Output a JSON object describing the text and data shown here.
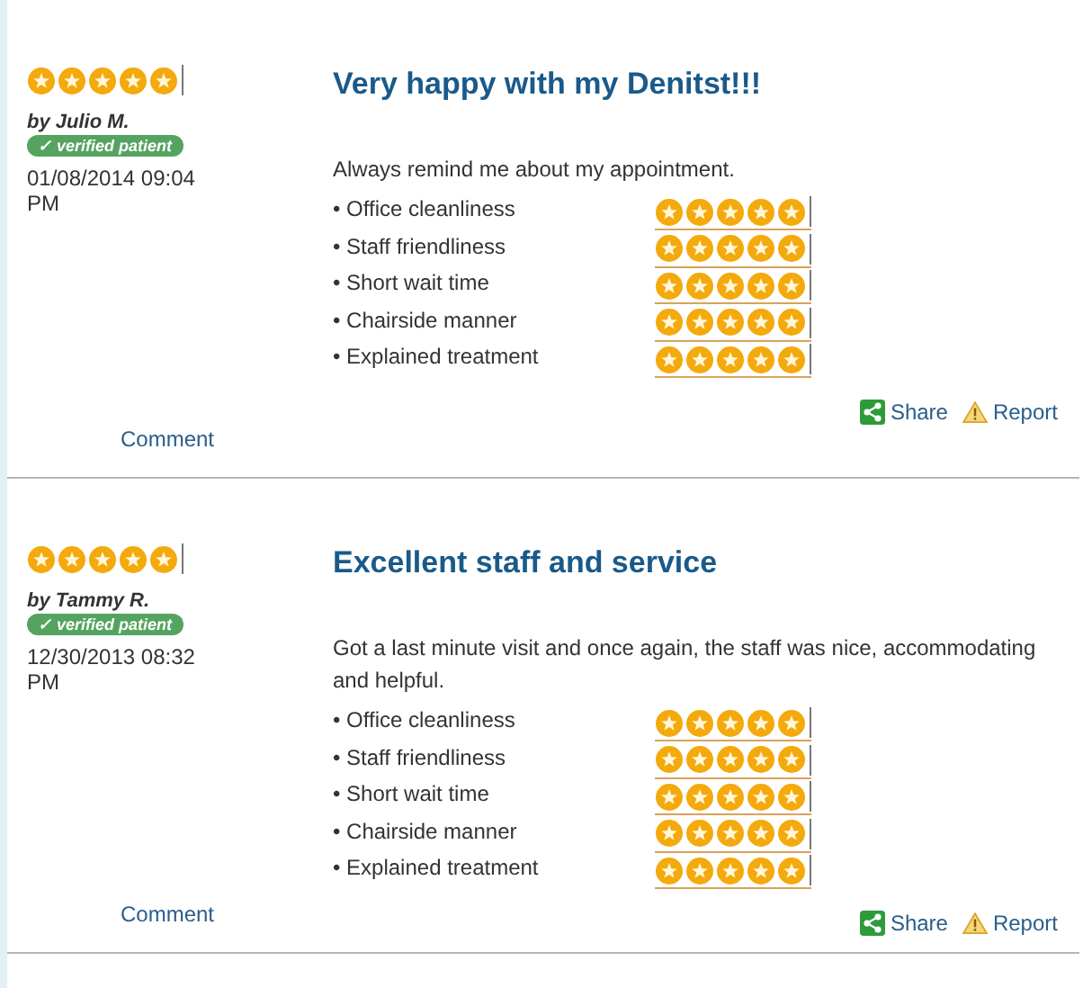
{
  "reviews": [
    {
      "stars": 5,
      "author": "by Julio M.",
      "badge": "✓ verified patient",
      "date": "01/08/2014 09:04 PM",
      "comment": "Comment",
      "title": "Very happy with my Denitst!!!",
      "body": "Always remind me about my appointment.",
      "ratings": [
        {
          "label": "• Office cleanliness",
          "stars": 5
        },
        {
          "label": "• Staff friendliness",
          "stars": 5
        },
        {
          "label": "• Short wait time",
          "stars": 5
        },
        {
          "label": "• Chairside manner",
          "stars": 5
        },
        {
          "label": "• Explained treatment",
          "stars": 5
        }
      ],
      "share": "Share",
      "report": "Report"
    },
    {
      "stars": 5,
      "author": "by Tammy R.",
      "badge": "✓ verified patient",
      "date": "12/30/2013 08:32 PM",
      "comment": "Comment",
      "title": "Excellent staff and service",
      "body": "Got a last minute visit and once again, the staff was nice, accommodating and helpful.",
      "ratings": [
        {
          "label": "• Office cleanliness",
          "stars": 5
        },
        {
          "label": "• Staff friendliness",
          "stars": 5
        },
        {
          "label": "• Short wait time",
          "stars": 5
        },
        {
          "label": "• Chairside manner",
          "stars": 5
        },
        {
          "label": "• Explained treatment",
          "stars": 5
        }
      ],
      "share": "Share",
      "report": "Report"
    }
  ]
}
